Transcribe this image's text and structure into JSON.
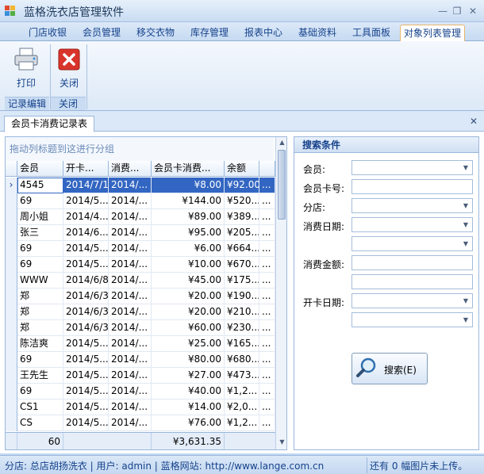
{
  "window": {
    "title": "蓝格洗衣店管理软件"
  },
  "menu": {
    "tabs": [
      "门店收银",
      "会员管理",
      "移交衣物",
      "库存管理",
      "报表中心",
      "基础资料",
      "工具面板",
      "对象列表管理"
    ],
    "active": 7
  },
  "ribbon": {
    "print_label": "打印",
    "close_label": "关闭",
    "group_records": "记录编辑",
    "group_close": "关闭"
  },
  "doc": {
    "tab_label": "会员卡消费记录表"
  },
  "grid": {
    "group_hint": "拖动列标题到这进行分组",
    "headers": [
      "会员",
      "开卡...",
      "消费...",
      "会员卡消费...",
      "余额"
    ],
    "rows": [
      [
        "4545",
        "2014/7/1",
        "2014/...",
        "¥8.00",
        "¥92.00",
        "..."
      ],
      [
        "69",
        "2014/5...",
        "2014/...",
        "¥144.00",
        "¥520...",
        "..."
      ],
      [
        "周小姐",
        "2014/4...",
        "2014/...",
        "¥89.00",
        "¥389...",
        "..."
      ],
      [
        "张三",
        "2014/6...",
        "2014/...",
        "¥95.00",
        "¥205...",
        "..."
      ],
      [
        "69",
        "2014/5...",
        "2014/...",
        "¥6.00",
        "¥664...",
        "..."
      ],
      [
        "69",
        "2014/5...",
        "2014/...",
        "¥10.00",
        "¥670...",
        "..."
      ],
      [
        "WWW",
        "2014/6/8",
        "2014/...",
        "¥45.00",
        "¥175...",
        "..."
      ],
      [
        "郑",
        "2014/6/3",
        "2014/...",
        "¥20.00",
        "¥190...",
        "..."
      ],
      [
        "郑",
        "2014/6/3",
        "2014/...",
        "¥20.00",
        "¥210...",
        "..."
      ],
      [
        "郑",
        "2014/6/3",
        "2014/...",
        "¥60.00",
        "¥230...",
        "..."
      ],
      [
        "陈洁爽",
        "2014/5...",
        "2014/...",
        "¥25.00",
        "¥165...",
        "..."
      ],
      [
        "69",
        "2014/5...",
        "2014/...",
        "¥80.00",
        "¥680...",
        "..."
      ],
      [
        "王先生",
        "2014/5...",
        "2014/...",
        "¥27.00",
        "¥473...",
        "..."
      ],
      [
        "69",
        "2014/5...",
        "2014/...",
        "¥40.00",
        "¥1,2...",
        "..."
      ],
      [
        "CS1",
        "2014/5...",
        "2014/...",
        "¥14.00",
        "¥2,0...",
        "..."
      ],
      [
        "CS",
        "2014/5...",
        "2014/...",
        "¥76.00",
        "¥1,2...",
        "..."
      ]
    ],
    "footer": {
      "count": "60",
      "sum": "¥3,631.35"
    }
  },
  "search": {
    "title": "搜索条件",
    "label_member": "会员:",
    "label_card_no": "会员卡号:",
    "label_store": "分店:",
    "label_consume_date": "消费日期:",
    "label_amount": "消费金额:",
    "label_open_date": "开卡日期:",
    "button_label": "搜索(E)"
  },
  "status": {
    "left": "分店: 总店胡扬洗衣 | 用户: admin | 蓝格网站: http://www.lange.com.cn",
    "right": "还有 0 幅图片未上传。"
  }
}
